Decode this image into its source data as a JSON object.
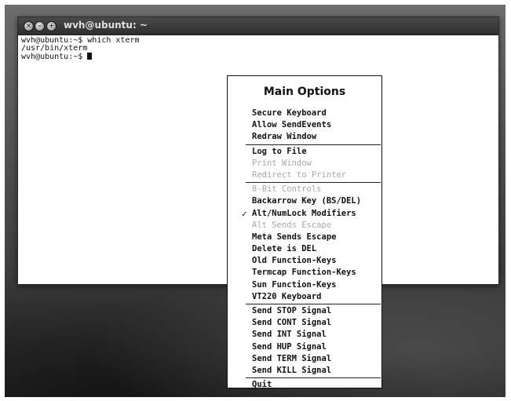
{
  "window": {
    "title": "wvh@ubuntu: ~",
    "buttons": {
      "close_glyph": "×",
      "min_glyph": "–",
      "max_glyph": "+"
    }
  },
  "terminal": {
    "lines": [
      "wvh@ubuntu:~$ which xterm",
      "/usr/bin/xterm",
      "wvh@ubuntu:~$ "
    ]
  },
  "menu": {
    "title": "Main Options",
    "groups": [
      [
        {
          "label": "Secure Keyboard",
          "enabled": true
        },
        {
          "label": "Allow SendEvents",
          "enabled": true
        },
        {
          "label": "Redraw Window",
          "enabled": true
        }
      ],
      [
        {
          "label": "Log to File",
          "enabled": true
        },
        {
          "label": "Print Window",
          "enabled": false
        },
        {
          "label": "Redirect to Printer",
          "enabled": false
        }
      ],
      [
        {
          "label": "8-Bit Controls",
          "enabled": false
        },
        {
          "label": "Backarrow Key (BS/DEL)",
          "enabled": true
        },
        {
          "label": "Alt/NumLock Modifiers",
          "enabled": true,
          "checked": true
        },
        {
          "label": "Alt Sends Escape",
          "enabled": false
        },
        {
          "label": "Meta Sends Escape",
          "enabled": true
        },
        {
          "label": "Delete is DEL",
          "enabled": true
        },
        {
          "label": "Old Function-Keys",
          "enabled": true
        },
        {
          "label": "Termcap Function-Keys",
          "enabled": true
        },
        {
          "label": "Sun Function-Keys",
          "enabled": true
        },
        {
          "label": "VT220 Keyboard",
          "enabled": true
        }
      ],
      [
        {
          "label": "Send STOP Signal",
          "enabled": true
        },
        {
          "label": "Send CONT Signal",
          "enabled": true
        },
        {
          "label": "Send INT Signal",
          "enabled": true
        },
        {
          "label": "Send HUP Signal",
          "enabled": true
        },
        {
          "label": "Send TERM Signal",
          "enabled": true
        },
        {
          "label": "Send KILL Signal",
          "enabled": true
        }
      ],
      [
        {
          "label": "Quit",
          "enabled": true
        }
      ]
    ],
    "check_glyph": "✓"
  }
}
